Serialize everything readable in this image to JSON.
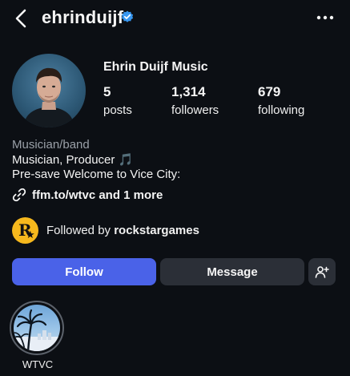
{
  "header": {
    "username": "ehrinduijf",
    "back_icon": "chevron-left-icon",
    "verified_icon": "verified-badge-icon",
    "more_icon": "more-horizontal-icon"
  },
  "profile": {
    "display_name": "Ehrin Duijf Music",
    "stats": {
      "posts_count": "5",
      "posts_label": "posts",
      "followers_count": "1,314",
      "followers_label": "followers",
      "following_count": "679",
      "following_label": "following"
    },
    "bio": {
      "category": "Musician/band",
      "line1": "Musician, Producer 🎵",
      "line2": "Pre-save Welcome to Vice City:",
      "link_icon": "link-icon",
      "link_text": "ffm.to/wtvc and 1 more"
    },
    "followed_by": {
      "prefix": "Followed by ",
      "account": "rockstargames"
    }
  },
  "actions": {
    "follow_label": "Follow",
    "message_label": "Message",
    "add_user_icon": "add-person-icon"
  },
  "highlights": [
    {
      "label": "WTVC"
    }
  ],
  "colors": {
    "background": "#0c0f14",
    "follow_button": "#4a62e8",
    "secondary_button": "#2b2f37",
    "verified": "#3897f0",
    "rockstar_logo": "#f6b81d"
  }
}
